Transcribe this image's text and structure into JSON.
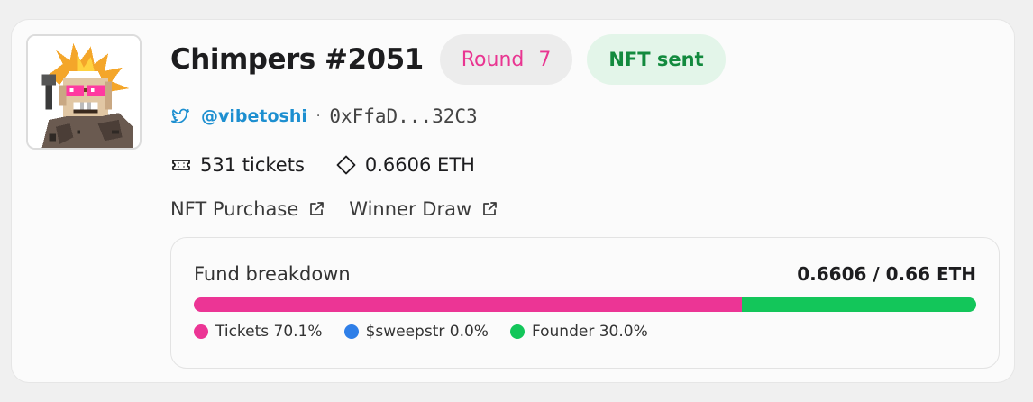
{
  "nft": {
    "name": "Chimpers #2051",
    "round_label": "Round",
    "round_number": "7",
    "status": "NFT sent"
  },
  "owner": {
    "twitter_handle": "@vibetoshi",
    "separator": "·",
    "wallet": "0xFfaD...32C3"
  },
  "stats": {
    "tickets": "531 tickets",
    "eth": "0.6606 ETH"
  },
  "links": {
    "purchase": "NFT Purchase",
    "draw": "Winner Draw"
  },
  "fund": {
    "label": "Fund breakdown",
    "total": "0.6606 / 0.66 ETH",
    "segments": [
      {
        "name": "Tickets",
        "label": "Tickets 70.1%",
        "percent": 70.1,
        "color": "#ec3595"
      },
      {
        "name": "$sweepstr",
        "label": "$sweepstr 0.0%",
        "percent": 0.0,
        "color": "#2f7fe8"
      },
      {
        "name": "Founder",
        "label": "Founder 30.0%",
        "percent": 30.0,
        "color": "#13c65a"
      }
    ]
  },
  "icons": {
    "twitter": "twitter-icon",
    "ticket": "ticket-icon",
    "eth": "eth-diamond-icon",
    "external": "external-link-icon"
  }
}
